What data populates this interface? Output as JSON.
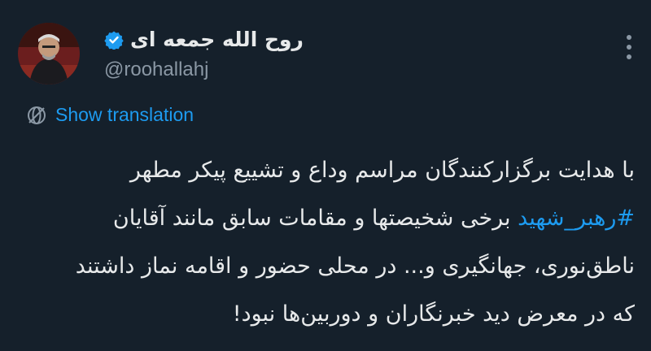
{
  "author": {
    "display_name": "روح الله جمعه ای",
    "handle": "@roohallahj",
    "verified": true,
    "verified_badge_color": "#1d9bf0"
  },
  "icons": {
    "verified": "verified-badge-icon",
    "more": "more-options-icon",
    "translate": "translate-globe-icon"
  },
  "translation_link": "Show translation",
  "tweet": {
    "line1": "با هدایت برگزارکنندگان مراسم وداع و تشییع پیکر مطهر",
    "hashtag": "#رهبر_شهید",
    "line2_rest": " برخی شخیصتها و مقامات سابق مانند آقایان",
    "line3": "ناطق‌نوری، جهانگیری و... در محلی حضور و اقامه نماز داشتند",
    "line4": "که در معرض دید خبرنگاران و دوربین‌ها نبود!"
  },
  "colors": {
    "background": "#15202b",
    "text": "#e7e9ea",
    "secondary_text": "#8b98a5",
    "link": "#1d9bf0"
  }
}
